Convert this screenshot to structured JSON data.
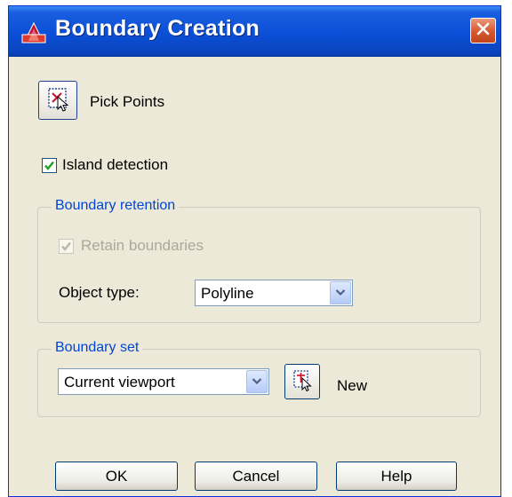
{
  "window": {
    "title": "Boundary Creation",
    "app_icon": "autocad-icon",
    "close_icon": "close-icon"
  },
  "pick_points": {
    "label": "Pick Points",
    "icon": "pick-points-icon"
  },
  "island_detection": {
    "label": "Island detection",
    "checked": true
  },
  "boundary_retention": {
    "title": "Boundary retention",
    "retain_boundaries": {
      "label": "Retain boundaries",
      "checked": true,
      "enabled": false
    },
    "object_type": {
      "label": "Object type:",
      "value": "Polyline"
    }
  },
  "boundary_set": {
    "title": "Boundary set",
    "value": "Current viewport",
    "new_label": "New",
    "new_icon": "select-objects-icon"
  },
  "buttons": {
    "ok": "OK",
    "cancel": "Cancel",
    "help": "Help"
  },
  "colors": {
    "title_bar": "#0a4fd6",
    "dialog_bg": "#ece9d8",
    "group_title": "#0046d5",
    "close": "#d4582f"
  }
}
